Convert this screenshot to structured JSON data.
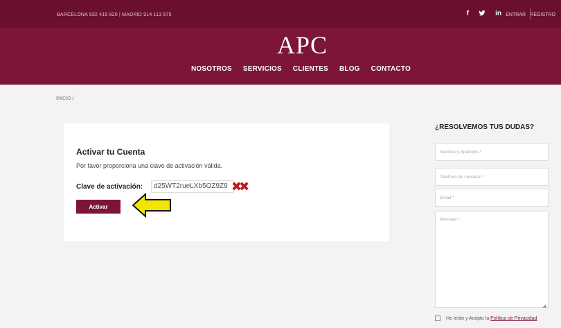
{
  "topbar": {
    "phones": "BARCELONA 932 415 820 | MADRID 914 113 575",
    "facebook": "f",
    "twitter": "🐦",
    "linkedin": "in",
    "entrar": "ENTRAR",
    "registro": "REGISTRO"
  },
  "header": {
    "logo": "APC",
    "nav": [
      "NOSOTROS",
      "SERVICIOS",
      "CLIENTES",
      "BLOG",
      "CONTACTO"
    ]
  },
  "breadcrumb": "INICIO /",
  "activation": {
    "title": "Activar tu Cuenta",
    "message": "Por favor proporciona una clave de activación válida.",
    "code_label": "Clave de activación:",
    "code_value": "d25WT2rueLXb5OZ9Z9",
    "button_label": "Activar"
  },
  "sidebar": {
    "title": "¿RESOLVEMOS TUS DUDAS?",
    "name_placeholder": "Nombre y Apellidos *",
    "phone_placeholder": "Teléfono de contacto *",
    "email_placeholder": "Email *",
    "message_placeholder": "Mensaje *",
    "privacy_text": "He leído y Acepto la",
    "privacy_link": "Política de Privacidad"
  },
  "colors": {
    "brand": "#7d1636",
    "topbar": "#6a0f2e",
    "arrow": "#f0e600"
  }
}
